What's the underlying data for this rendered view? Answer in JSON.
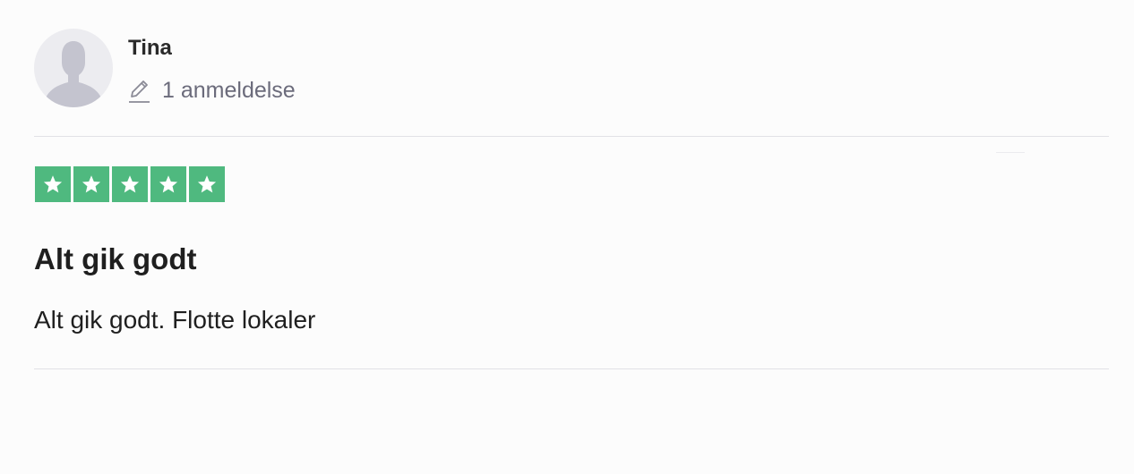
{
  "consumer": {
    "name": "Tina",
    "review_count_label": "1 anmeldelse",
    "avatar_icon": "default-user-avatar-icon",
    "review_count_icon": "pencil-icon"
  },
  "review": {
    "rating": 5,
    "rating_max": 5,
    "star_color": "#4fb97f",
    "title": "Alt gik godt",
    "text": "Alt gik godt. Flotte lokaler"
  },
  "colors": {
    "name_text": "#2a2a2a",
    "secondary_text": "#6b6b7b",
    "divider": "#e1e1e6",
    "avatar_bg": "#ececf0",
    "avatar_silhouette": "#c4c4cf"
  }
}
